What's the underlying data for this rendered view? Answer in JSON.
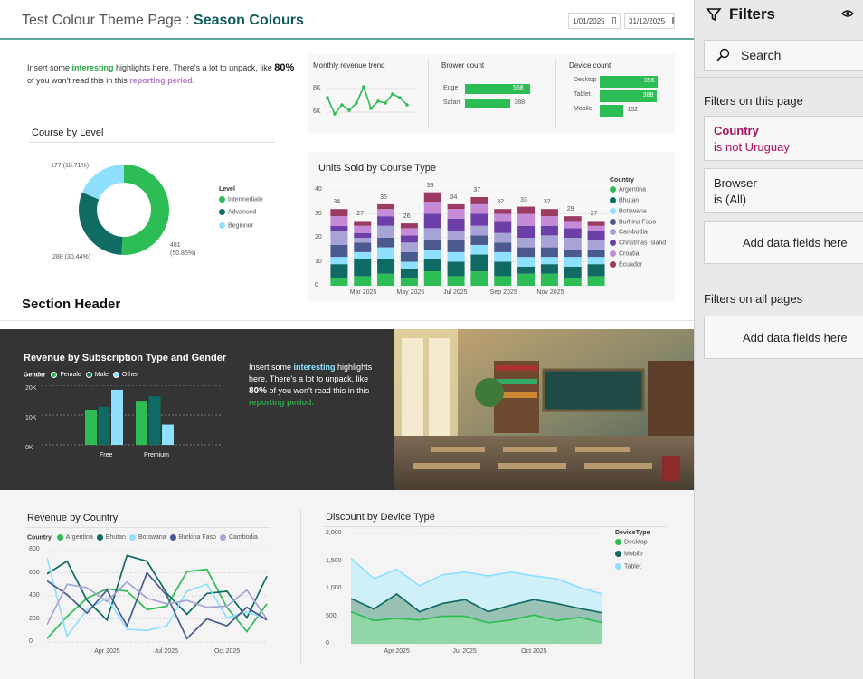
{
  "header": {
    "title_prefix": "Test Colour Theme Page : ",
    "title_strong": "Season Colours",
    "date_start": "1/01/2025",
    "date_end": "31/12/2025"
  },
  "intro": {
    "part1": "Insert some ",
    "highlight1": "interesting",
    "part2": " highlights here. There's a lot to unpack, like ",
    "percent": "80%",
    "part3": " of you won't read this in this ",
    "highlight2": "reporting period."
  },
  "kpis": {
    "monthly_title": "Monthly revenue trend",
    "monthly_ticks": [
      "8K",
      "6K"
    ],
    "browser_title": "Brower count",
    "browser": [
      {
        "label": "Edge",
        "value": "558",
        "frac": 1.0
      },
      {
        "label": "Safari",
        "value": "388",
        "frac": 0.7
      }
    ],
    "device_title": "Device count",
    "device": [
      {
        "label": "Desktop",
        "value": "396",
        "frac": 1.0
      },
      {
        "label": "Tablet",
        "value": "388",
        "frac": 0.98
      },
      {
        "label": "Mobile",
        "value": "162",
        "frac": 0.41
      }
    ]
  },
  "donut": {
    "title": "Course by Level",
    "legend_title": "Level",
    "legend": [
      "Intermediate",
      "Advanced",
      "Beginner"
    ],
    "label_intermediate_a": "481",
    "label_intermediate_b": "(50.85%)",
    "label_advanced": "288 (30.44%)",
    "label_beginner": "177 (18.71%)"
  },
  "stack": {
    "title": "Units Sold by Course Type",
    "legend_title": "Country",
    "legend": [
      "Argentina",
      "Bhutan",
      "Botswana",
      "Burkina Faso",
      "Cambodia",
      "Christmas Island",
      "Croatia",
      "Ecuador"
    ],
    "y_ticks": [
      "40",
      "30",
      "20",
      "10",
      "0"
    ],
    "x_ticks": [
      "Mar 2025",
      "May 2025",
      "Jul 2025",
      "Sep 2025",
      "Nov 2025"
    ],
    "totals": [
      "34",
      "27",
      "35",
      "26",
      "39",
      "34",
      "37",
      "32",
      "33",
      "32",
      "29",
      "27"
    ]
  },
  "section_header": "Section Header",
  "dark": {
    "title": "Revenue by Subscription Type and Gender",
    "legend_title": "Gender",
    "legend": [
      "Female",
      "Male",
      "Other"
    ],
    "y_ticks": [
      "20K",
      "10K",
      "0K"
    ],
    "x_ticks": [
      "Free",
      "Premium"
    ],
    "text_part1": "Insert some ",
    "text_highlight1": "interesting",
    "text_part2": " highlights here. There's a lot to unpack, like ",
    "text_percent": "80%",
    "text_part3": " of you won't read this in this ",
    "text_highlight2": "reporting period."
  },
  "country": {
    "title": "Revenue by Country",
    "legend_title": "Country",
    "legend": [
      "Argentina",
      "Bhutan",
      "Botswana",
      "Burkina Faso",
      "Cambodia"
    ],
    "y_ticks": [
      "800",
      "600",
      "400",
      "200",
      "0"
    ],
    "x_ticks": [
      "Apr 2025",
      "Jul 2025",
      "Oct 2025"
    ]
  },
  "discount": {
    "title": "Discount by Device Type",
    "legend_title": "DeviceType",
    "legend": [
      "Desktop",
      "Mobile",
      "Tablet"
    ],
    "y_ticks": [
      "2,000",
      "1,500",
      "1,000",
      "500",
      "0"
    ],
    "x_ticks": [
      "Apr 2025",
      "Jul 2025",
      "Oct 2025"
    ]
  },
  "filters": {
    "title": "Filters",
    "search": "Search",
    "on_page": "Filters on this page",
    "country_name": "Country",
    "country_value": "is not Uruguay",
    "browser_name": "Browser",
    "browser_value": "is (All)",
    "add_fields": "Add data fields here",
    "on_all": "Filters on all pages",
    "add_fields_all": "Add data fields here"
  },
  "colors": {
    "argentina": "#2dbd55",
    "bhutan": "#0f6b64",
    "botswana": "#8fe0ff",
    "burkina": "#4a5a8f",
    "cambodia": "#a6a3d6",
    "christmas": "#6c3fa8",
    "croatia": "#c58bd9",
    "ecuador": "#9b3a63"
  }
}
